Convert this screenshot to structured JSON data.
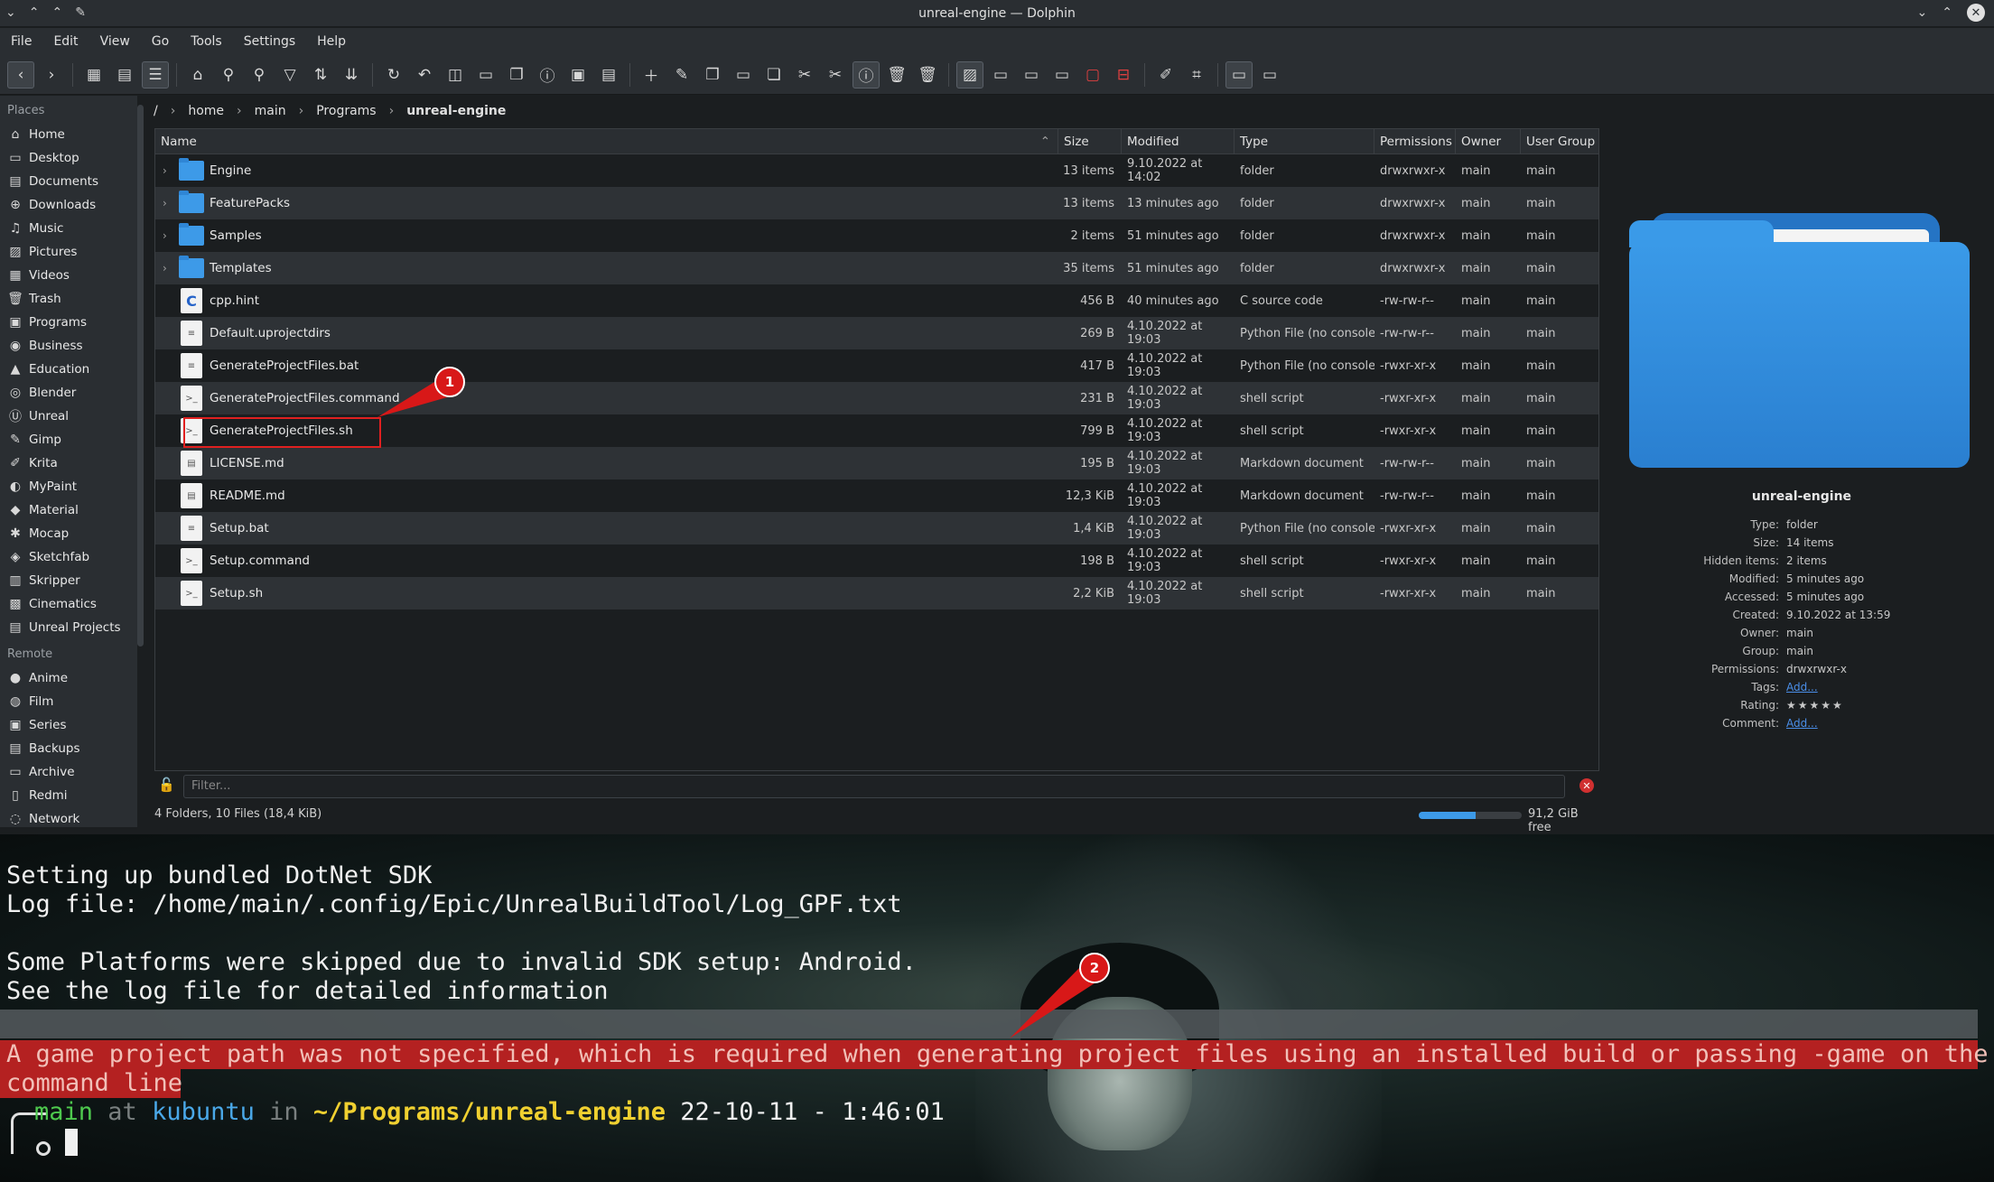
{
  "window": {
    "title": "unreal-engine — Dolphin"
  },
  "menu": [
    "File",
    "Edit",
    "View",
    "Go",
    "Tools",
    "Settings",
    "Help"
  ],
  "breadcrumb": {
    "root": "/",
    "parts": [
      "home",
      "main",
      "Programs"
    ],
    "current": "unreal-engine"
  },
  "places": {
    "header": "Places",
    "items": [
      {
        "label": "Home",
        "icon": "home-icon"
      },
      {
        "label": "Desktop",
        "icon": "desktop-icon"
      },
      {
        "label": "Documents",
        "icon": "documents-icon"
      },
      {
        "label": "Downloads",
        "icon": "downloads-icon"
      },
      {
        "label": "Music",
        "icon": "music-icon"
      },
      {
        "label": "Pictures",
        "icon": "pictures-icon"
      },
      {
        "label": "Videos",
        "icon": "videos-icon"
      },
      {
        "label": "Trash",
        "icon": "trash-icon"
      },
      {
        "label": "Programs",
        "icon": "programs-icon"
      },
      {
        "label": "Business",
        "icon": "business-icon"
      },
      {
        "label": "Education",
        "icon": "education-icon"
      },
      {
        "label": "Blender",
        "icon": "blender-icon"
      },
      {
        "label": "Unreal",
        "icon": "unreal-icon"
      },
      {
        "label": "Gimp",
        "icon": "gimp-icon"
      },
      {
        "label": "Krita",
        "icon": "krita-icon"
      },
      {
        "label": "MyPaint",
        "icon": "mypaint-icon"
      },
      {
        "label": "Material",
        "icon": "material-icon"
      },
      {
        "label": "Mocap",
        "icon": "mocap-icon"
      },
      {
        "label": "Sketchfab",
        "icon": "sketchfab-icon"
      },
      {
        "label": "Skripper",
        "icon": "skripper-icon"
      },
      {
        "label": "Cinematics",
        "icon": "cinematics-icon"
      },
      {
        "label": "Unreal Projects",
        "icon": "unreal-projects-icon"
      }
    ],
    "remote_header": "Remote",
    "remote_items": [
      {
        "label": "Anime",
        "icon": "anime-icon"
      },
      {
        "label": "Film",
        "icon": "film-icon"
      },
      {
        "label": "Series",
        "icon": "series-icon"
      },
      {
        "label": "Backups",
        "icon": "backups-icon"
      },
      {
        "label": "Archive",
        "icon": "archive-icon"
      },
      {
        "label": "Redmi",
        "icon": "phone-icon"
      },
      {
        "label": "Network",
        "icon": "network-icon"
      }
    ]
  },
  "columns": [
    "Name",
    "Size",
    "Modified",
    "Type",
    "Permissions",
    "Owner",
    "User Group"
  ],
  "files": [
    {
      "name": "Engine",
      "kind": "folder",
      "size": "13 items",
      "modified": "9.10.2022 at 14:02",
      "type": "folder",
      "perm": "drwxrwxr-x",
      "owner": "main",
      "group": "main"
    },
    {
      "name": "FeaturePacks",
      "kind": "folder",
      "size": "13 items",
      "modified": "13 minutes ago",
      "type": "folder",
      "perm": "drwxrwxr-x",
      "owner": "main",
      "group": "main"
    },
    {
      "name": "Samples",
      "kind": "folder",
      "size": "2 items",
      "modified": "51 minutes ago",
      "type": "folder",
      "perm": "drwxrwxr-x",
      "owner": "main",
      "group": "main"
    },
    {
      "name": "Templates",
      "kind": "folder",
      "size": "35 items",
      "modified": "51 minutes ago",
      "type": "folder",
      "perm": "drwxrwxr-x",
      "owner": "main",
      "group": "main"
    },
    {
      "name": "cpp.hint",
      "kind": "c",
      "size": "456 B",
      "modified": "40 minutes ago",
      "type": "C source code",
      "perm": "-rw-rw-r--",
      "owner": "main",
      "group": "main"
    },
    {
      "name": "Default.uprojectdirs",
      "kind": "doc",
      "size": "269 B",
      "modified": "4.10.2022 at 19:03",
      "type": "Python File (no console)",
      "perm": "-rw-rw-r--",
      "owner": "main",
      "group": "main"
    },
    {
      "name": "GenerateProjectFiles.bat",
      "kind": "doc",
      "size": "417 B",
      "modified": "4.10.2022 at 19:03",
      "type": "Python File (no console)",
      "perm": "-rwxr-xr-x",
      "owner": "main",
      "group": "main"
    },
    {
      "name": "GenerateProjectFiles.command",
      "kind": "script",
      "size": "231 B",
      "modified": "4.10.2022 at 19:03",
      "type": "shell script",
      "perm": "-rwxr-xr-x",
      "owner": "main",
      "group": "main"
    },
    {
      "name": "GenerateProjectFiles.sh",
      "kind": "script",
      "size": "799 B",
      "modified": "4.10.2022 at 19:03",
      "type": "shell script",
      "perm": "-rwxr-xr-x",
      "owner": "main",
      "group": "main"
    },
    {
      "name": "LICENSE.md",
      "kind": "md",
      "size": "195 B",
      "modified": "4.10.2022 at 19:03",
      "type": "Markdown document",
      "perm": "-rw-rw-r--",
      "owner": "main",
      "group": "main"
    },
    {
      "name": "README.md",
      "kind": "md",
      "size": "12,3 KiB",
      "modified": "4.10.2022 at 19:03",
      "type": "Markdown document",
      "perm": "-rw-rw-r--",
      "owner": "main",
      "group": "main"
    },
    {
      "name": "Setup.bat",
      "kind": "doc",
      "size": "1,4 KiB",
      "modified": "4.10.2022 at 19:03",
      "type": "Python File (no console)",
      "perm": "-rwxr-xr-x",
      "owner": "main",
      "group": "main"
    },
    {
      "name": "Setup.command",
      "kind": "script",
      "size": "198 B",
      "modified": "4.10.2022 at 19:03",
      "type": "shell script",
      "perm": "-rwxr-xr-x",
      "owner": "main",
      "group": "main"
    },
    {
      "name": "Setup.sh",
      "kind": "script",
      "size": "2,2 KiB",
      "modified": "4.10.2022 at 19:03",
      "type": "shell script",
      "perm": "-rwxr-xr-x",
      "owner": "main",
      "group": "main"
    }
  ],
  "filter": {
    "placeholder": "Filter..."
  },
  "status": {
    "summary": "4 Folders, 10 Files (18,4 KiB)",
    "free": "91,2 GiB free",
    "used_fraction": 0.55
  },
  "info_panel": {
    "name": "unreal-engine",
    "rows": [
      {
        "k": "Type:",
        "v": "folder"
      },
      {
        "k": "Size:",
        "v": "14 items"
      },
      {
        "k": "Hidden items:",
        "v": "2 items"
      },
      {
        "k": "Modified:",
        "v": "5 minutes ago"
      },
      {
        "k": "Accessed:",
        "v": "5 minutes ago"
      },
      {
        "k": "Created:",
        "v": "9.10.2022 at 13:59"
      },
      {
        "k": "Owner:",
        "v": "main"
      },
      {
        "k": "Group:",
        "v": "main"
      },
      {
        "k": "Permissions:",
        "v": "drwxrwxr-x"
      },
      {
        "k": "Tags:",
        "v": "Add...",
        "link": true
      },
      {
        "k": "Rating:",
        "v": "★★★★★"
      },
      {
        "k": "Comment:",
        "v": "Add...",
        "link": true
      }
    ]
  },
  "terminal": {
    "lines": [
      "Setting up bundled DotNet SDK",
      "Log file: /home/main/.config/Epic/UnrealBuildTool/Log_GPF.txt",
      "",
      "Some Platforms were skipped due to invalid SDK setup: Android.",
      "See the log file for detailed information"
    ],
    "error_line1": "A game project path was not specified, which is required when generating project files using an installed build or passing -game on the",
    "error_line2": "command line",
    "prompt_user": "main",
    "prompt_at": " at ",
    "prompt_host": "kubuntu",
    "prompt_in": " in ",
    "prompt_path": "~/Programs/unreal-engine",
    "prompt_time": " 22-10-11 - 1:46:01"
  },
  "callouts": [
    "1",
    "2"
  ]
}
